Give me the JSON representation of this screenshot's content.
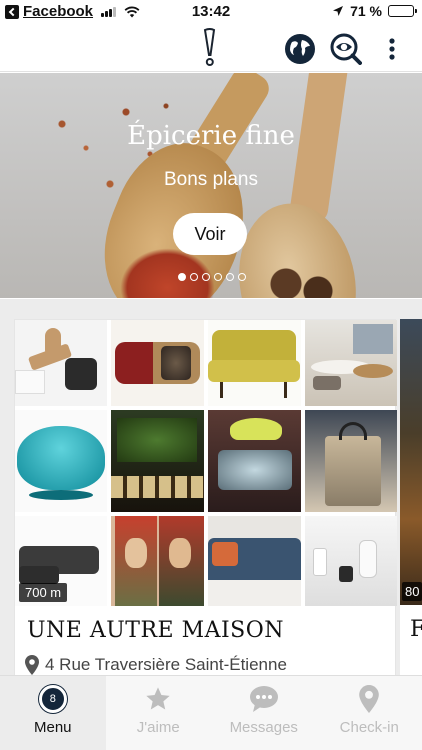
{
  "status_bar": {
    "back_app": "Facebook",
    "time": "13:42",
    "battery_percent": "71 %",
    "battery_level": 0.71
  },
  "header": {
    "logo_icon": "exclamation-logo-icon",
    "icons": [
      "globe-icon",
      "eye-search-icon",
      "more-vertical-icon"
    ]
  },
  "banner": {
    "title": "Épicerie fine",
    "subtitle": "Bons plans",
    "button_label": "Voir",
    "slides_total": 6,
    "active_slide": 1
  },
  "places": [
    {
      "name": "UNE AUTRE MAISON",
      "address": "4 Rue Traversière Saint-Étienne",
      "distance": "700 m"
    },
    {
      "name": "F",
      "distance": "80"
    }
  ],
  "tabbar": {
    "items": [
      {
        "label": "Menu",
        "icon": "menu-badge-icon",
        "badge": "8",
        "active": true
      },
      {
        "label": "J'aime",
        "icon": "star-icon",
        "active": false
      },
      {
        "label": "Messages",
        "icon": "chat-bubble-icon",
        "active": false
      },
      {
        "label": "Check-in",
        "icon": "location-pin-icon",
        "active": false
      }
    ]
  },
  "colors": {
    "brand_dark": "#14263a",
    "inactive_tab": "#bdbdbd",
    "background_gray": "#ececec"
  }
}
